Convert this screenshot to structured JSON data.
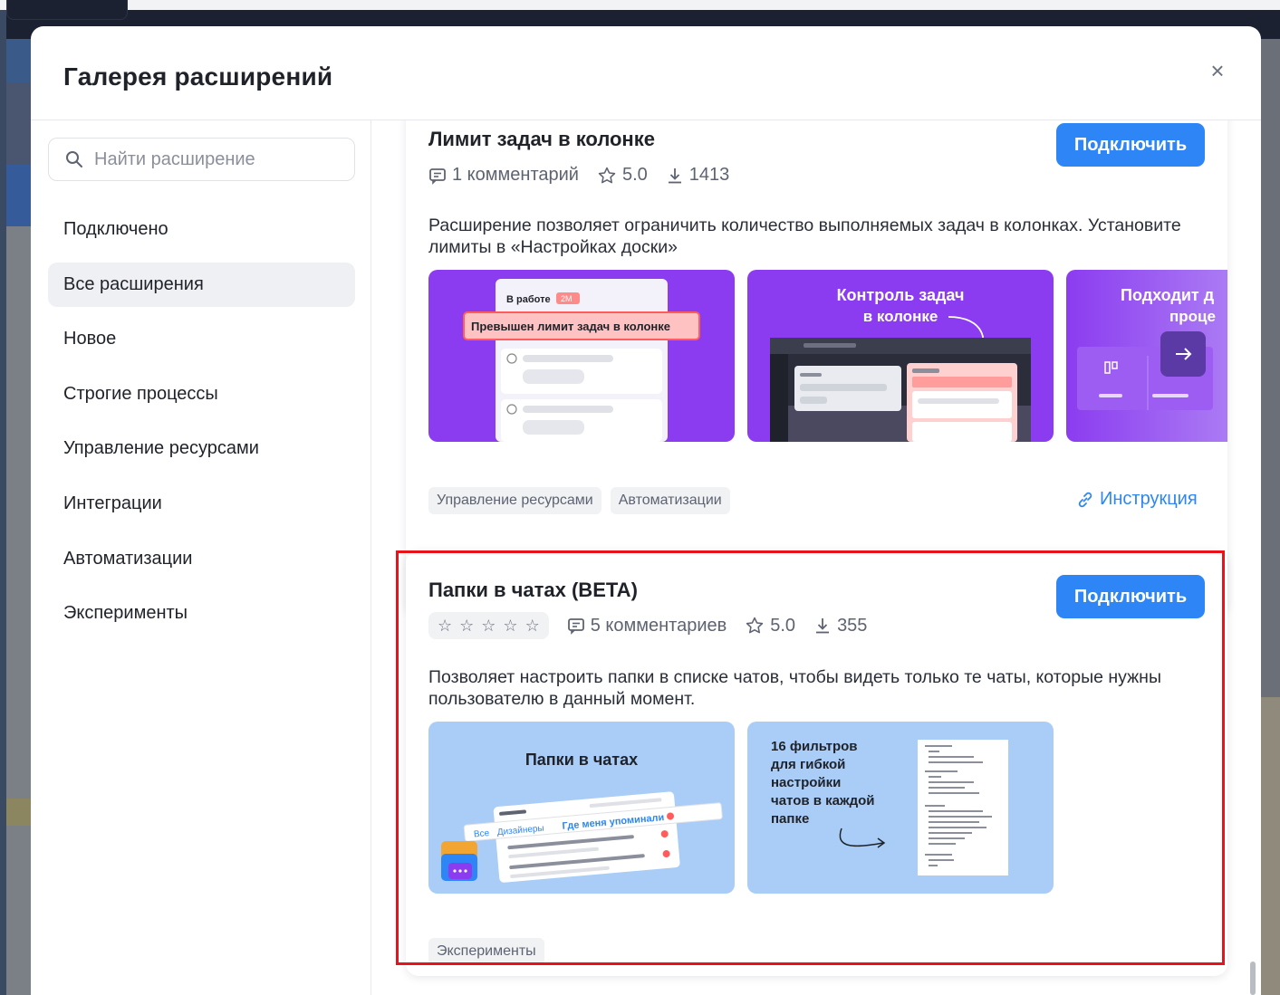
{
  "modal": {
    "title": "Галерея расширений",
    "close_label": "×"
  },
  "sidebar": {
    "search_placeholder": "Найти расширение",
    "items": [
      {
        "label": "Подключено"
      },
      {
        "label": "Все расширения",
        "active": true
      },
      {
        "label": "Новое"
      },
      {
        "label": "Строгие процессы"
      },
      {
        "label": "Управление ресурсами"
      },
      {
        "label": "Интеграции"
      },
      {
        "label": "Автоматизации"
      },
      {
        "label": "Эксперименты"
      }
    ]
  },
  "extensions": [
    {
      "title": "Лимит задач в колонке",
      "connect_label": "Подключить",
      "comments": "1 комментарий",
      "rating": "5.0",
      "downloads": "1413",
      "description": "Расширение позволяет ограничить количество выполняемых задач в колонках. Установите лимиты в «Настройках доски»",
      "thumbs": {
        "t1_col": "В работе",
        "t1_badge": "2М",
        "t1_alert": "Превышен лимит задач в колонке",
        "t2_line1": "Контроль задач",
        "t2_line2": "в колонке",
        "t3_line1": "Подходит д",
        "t3_line2": "проце"
      },
      "tags": [
        "Управление ресурсами",
        "Автоматизации"
      ],
      "instruction_label": "Инструкция"
    },
    {
      "title": "Папки в чатах (BETA)",
      "connect_label": "Подключить",
      "comments": "5 комментариев",
      "rating": "5.0",
      "downloads": "355",
      "description": "Позволяет настроить папки в списке чатов, чтобы видеть только те чаты, которые нужны пользователю в данный момент.",
      "thumbs": {
        "t1_title": "Папки в чатах",
        "t1_tab_all": "Все",
        "t1_tab_2": "Дизайнеры",
        "t1_tab_3": "Где меня упоминали",
        "t2_lines": [
          "16 фильтров",
          "для гибкой",
          "настройки",
          "чатов в каждой",
          "папке"
        ]
      },
      "tags": [
        "Эксперименты"
      ]
    }
  ],
  "colors": {
    "accent": "#2e86f6",
    "highlight": "#e8131a",
    "thumb_purple": "#8b3cf0",
    "thumb_blue": "#a9cdf7"
  }
}
